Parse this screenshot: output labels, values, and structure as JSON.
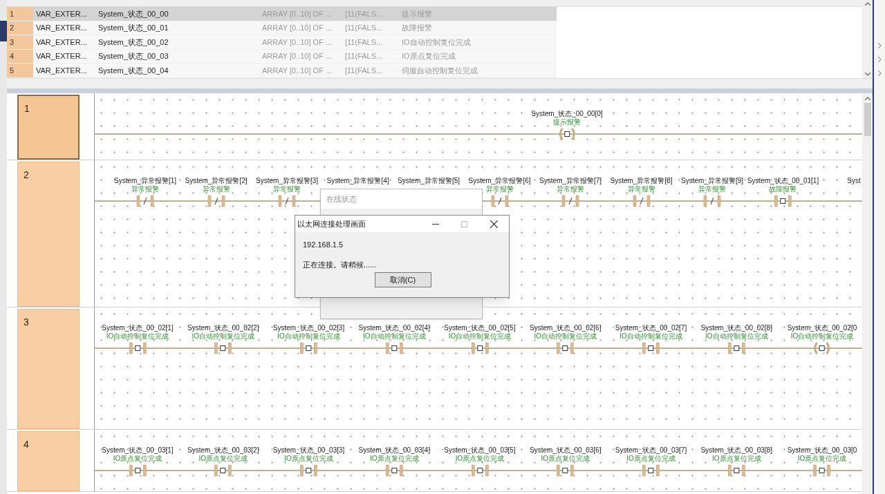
{
  "table": {
    "rows": [
      {
        "number": "1",
        "category": "VAR_EXTER...",
        "name": "System_状态_00_00",
        "type": "ARRAY [0..10] OF ...",
        "initial": "[11(FALS...",
        "comment": "提示报警",
        "selected": true
      },
      {
        "number": "2",
        "category": "VAR_EXTER...",
        "name": "System_状态_00_01",
        "type": "ARRAY [0..10] OF ...",
        "initial": "[11(FALS...",
        "comment": "故障报警",
        "selected": false
      },
      {
        "number": "3",
        "category": "VAR_EXTER...",
        "name": "System_状态_00_02",
        "type": "ARRAY [0..10] OF ...",
        "initial": "[11(FALS...",
        "comment": "IO自动控制复位完成",
        "selected": false
      },
      {
        "number": "4",
        "category": "VAR_EXTER...",
        "name": "System_状态_00_03",
        "type": "ARRAY [0..10] OF ...",
        "initial": "[11(FALS...",
        "comment": "IO原点复位完成",
        "selected": false
      },
      {
        "number": "5",
        "category": "VAR_EXTER...",
        "name": "System_状态_00_04",
        "type": "ARRAY [0..10] OF ...",
        "initial": "[11(FALS...",
        "comment": "伺服自动控制复位完成",
        "selected": false
      }
    ]
  },
  "ladder": {
    "rungs": [
      {
        "number": "1",
        "selected": true,
        "elements": [
          {
            "kind": "coil",
            "variable": "System_状态_00_00[0]",
            "comment": "提示报警"
          }
        ]
      },
      {
        "number": "2",
        "selected": false,
        "elements": [
          {
            "kind": "nc_contact",
            "variable": "System_异常报警[1]",
            "comment": "异常报警"
          },
          {
            "kind": "nc_contact",
            "variable": "System_异常报警[2]",
            "comment": "异常报警"
          },
          {
            "kind": "nc_contact",
            "variable": "System_异常报警[3]",
            "comment": "异常报警"
          },
          {
            "kind": "label_only",
            "variable": "System_异常报警[4]"
          },
          {
            "kind": "label_only",
            "variable": "System_异常报警[5]"
          },
          {
            "kind": "nc_contact",
            "variable": "System_异常报警[6]",
            "comment": "异常报警"
          },
          {
            "kind": "nc_contact",
            "variable": "System_异常报警[7]",
            "comment": "异常报警"
          },
          {
            "kind": "nc_contact",
            "variable": "System_异常报警[8]",
            "comment": "异常报警"
          },
          {
            "kind": "nc_contact",
            "variable": "System_异常报警[9]",
            "comment": "异常报警"
          },
          {
            "kind": "no_contact",
            "variable": "System_状态_00_01[1]",
            "comment": "故障报警"
          },
          {
            "kind": "label_only",
            "variable": "Syst"
          }
        ]
      },
      {
        "number": "3",
        "selected": false,
        "elements": [
          {
            "kind": "no_contact",
            "variable": "System_状态_00_02[1]",
            "comment": "IO自动控制复位完成"
          },
          {
            "kind": "no_contact",
            "variable": "System_状态_00_02[2]",
            "comment": "IO自动控制复位完成"
          },
          {
            "kind": "no_contact",
            "variable": "System_状态_00_02[3]",
            "comment": "IO自动控制复位完成"
          },
          {
            "kind": "no_contact",
            "variable": "System_状态_00_02[4]",
            "comment": "IO自动控制复位完成"
          },
          {
            "kind": "no_contact",
            "variable": "System_状态_00_02[5]",
            "comment": "IO自动控制复位完成"
          },
          {
            "kind": "no_contact",
            "variable": "System_状态_00_02[6]",
            "comment": "IO自动控制复位完成"
          },
          {
            "kind": "no_contact",
            "variable": "System_状态_00_02[7]",
            "comment": "IO自动控制复位完成"
          },
          {
            "kind": "no_contact",
            "variable": "System_状态_00_02[8]",
            "comment": "IO自动控制复位完成"
          },
          {
            "kind": "coil",
            "variable": "System_状态_00_02[0",
            "comment": "IO自动控制复位完成"
          }
        ]
      },
      {
        "number": "4",
        "selected": false,
        "elements": [
          {
            "kind": "no_contact",
            "variable": "System_状态_00_03[1]",
            "comment": "IO原点复位完成"
          },
          {
            "kind": "no_contact",
            "variable": "System_状态_00_03[2]",
            "comment": "IO原点复位完成"
          },
          {
            "kind": "no_contact",
            "variable": "System_状态_00_03[3]",
            "comment": "IO原点复位完成"
          },
          {
            "kind": "no_contact",
            "variable": "System_状态_00_03[4]",
            "comment": "IO原点复位完成"
          },
          {
            "kind": "no_contact",
            "variable": "System_状态_00_03[5]",
            "comment": "IO原点复位完成"
          },
          {
            "kind": "no_contact",
            "variable": "System_状态_00_03[6]",
            "comment": "IO原点复位完成"
          },
          {
            "kind": "no_contact",
            "variable": "System_状态_00_03[7]",
            "comment": "IO原点复位完成"
          },
          {
            "kind": "no_contact",
            "variable": "System_状态_00_03[8]",
            "comment": "IO原点复位完成"
          },
          {
            "kind": "no_contact",
            "variable": "System_状态_00_03[0",
            "comment": "IO原点复位完成"
          }
        ]
      }
    ]
  },
  "background_window": {
    "title": "在线状态"
  },
  "dialog": {
    "title": "以太网连接处理画面",
    "address": "192.168.1.5",
    "message": "正在连接。请稍候......",
    "cancel_button": "取消(C)"
  }
}
